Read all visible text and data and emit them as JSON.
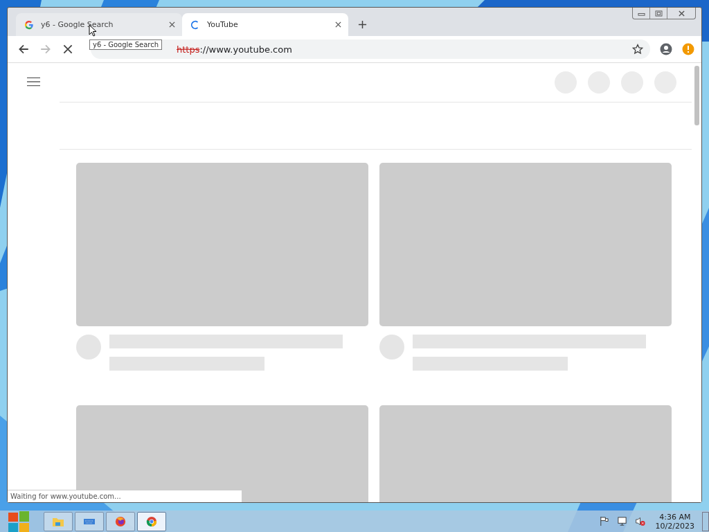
{
  "tabs": [
    {
      "title": "y6 - Google Search",
      "selected": false,
      "kind": "google"
    },
    {
      "title": "YouTube",
      "selected": true,
      "kind": "loading"
    }
  ],
  "tooltip": "y6 - Google Search",
  "address": {
    "scheme": "https",
    "rest": "://www.youtube.com"
  },
  "status": "Waiting for www.youtube.com...",
  "taskbar": {
    "apps": [
      {
        "kind": "folder",
        "selected": false
      },
      {
        "kind": "keyboard",
        "selected": false
      },
      {
        "kind": "firefox",
        "selected": false
      },
      {
        "kind": "chrome",
        "selected": true
      }
    ],
    "time": "4:36 AM",
    "date": "10/2/2023"
  }
}
